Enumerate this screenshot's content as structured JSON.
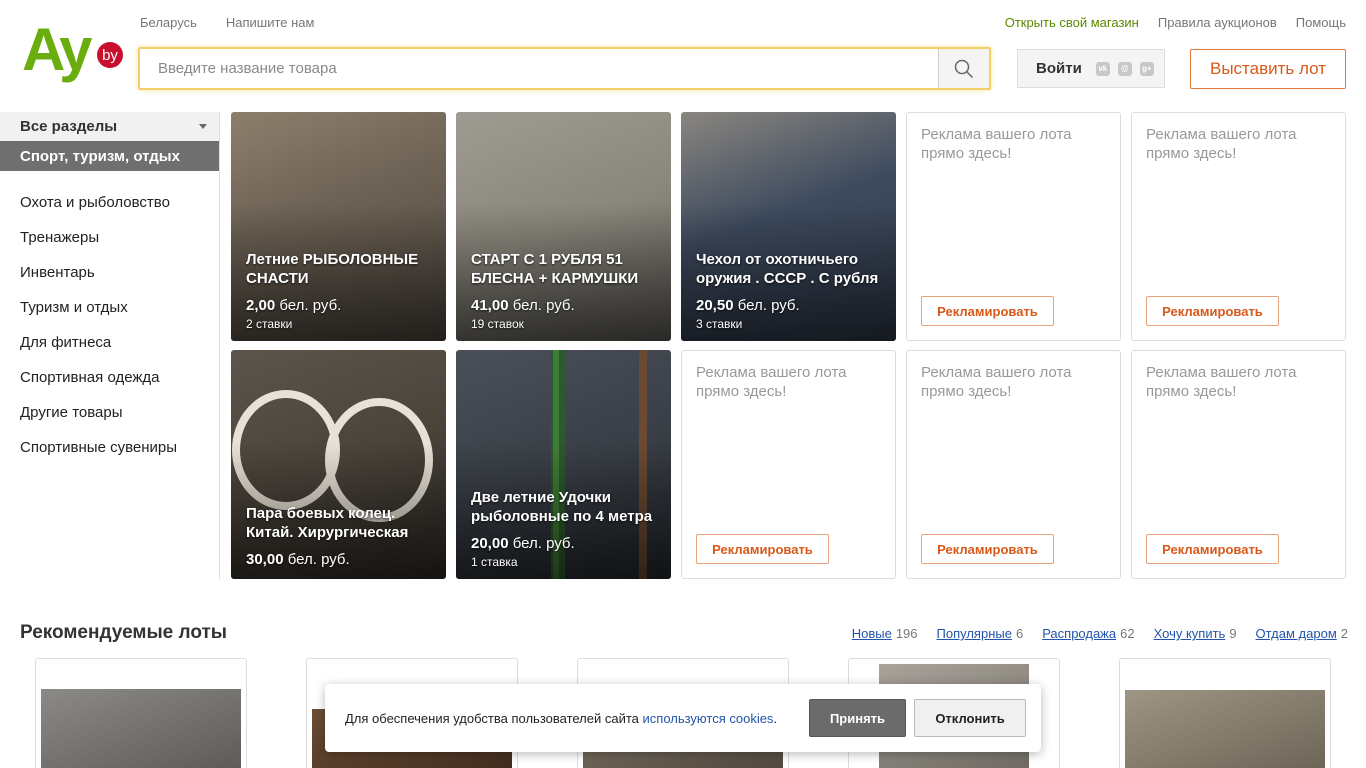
{
  "brand": {
    "logo_text": "Ay",
    "logo_badge": "by",
    "logo_color": "#6aad0e",
    "badge_color": "#c8102e"
  },
  "top_links_left": [
    "Беларусь",
    "Напишите нам"
  ],
  "top_links_right": {
    "shop": "Открыть свой магазин",
    "rules": "Правила аукционов",
    "help": "Помощь"
  },
  "search": {
    "placeholder": "Введите название товара",
    "button_icon": "search-icon"
  },
  "login": {
    "label": "Войти",
    "social_icons": [
      "vk-icon",
      "mail-ru-icon",
      "google-plus-icon"
    ]
  },
  "sell_button": "Выставить лот",
  "sidebar": {
    "all_sections": "Все разделы",
    "current": "Спорт, туризм, отдых",
    "items": [
      "Охота и рыболовство",
      "Тренажеры",
      "Инвентарь",
      "Туризм и отдых",
      "Для фитнеса",
      "Спортивная одежда",
      "Другие товары",
      "Спортивные сувениры"
    ]
  },
  "lots": [
    {
      "title": "Летние РЫБОЛОВНЫЕ СНАСТИ",
      "price": "2,00",
      "currency": "бел. руб.",
      "bids": "2 ставки"
    },
    {
      "title": "СТАРТ С 1 РУБЛЯ 51 БЛЕСНА + КАРМУШКИ",
      "price": "41,00",
      "currency": "бел. руб.",
      "bids": "19 ставок"
    },
    {
      "title": "Чехол от охотничьего оружия . СССР . С рубля",
      "price": "20,50",
      "currency": "бел. руб.",
      "bids": "3 ставки"
    },
    {
      "title": "Пара боевых колец. Китай. Хирургическая",
      "price": "30,00",
      "currency": "бел. руб.",
      "bids": ""
    },
    {
      "title": "Две летние Удочки рыболовные по 4 метра",
      "price": "20,00",
      "currency": "бел. руб.",
      "bids": "1 ставка"
    }
  ],
  "ad_tile": {
    "text": "Реклама вашего лота прямо здесь!",
    "button": "Рекламировать"
  },
  "recommended": {
    "title": "Рекомендуемые лоты",
    "tabs": [
      {
        "label": "Новые",
        "count": "196"
      },
      {
        "label": "Популярные",
        "count": "6"
      },
      {
        "label": "Распродажа",
        "count": "62"
      },
      {
        "label": "Хочу купить",
        "count": "9"
      },
      {
        "label": "Отдам даром",
        "count": "2"
      }
    ]
  },
  "cookie": {
    "text": "Для обеспечения удобства пользователей сайта ",
    "link": "используются cookies",
    "end": ".",
    "accept": "Принять",
    "decline": "Отклонить"
  },
  "colors": {
    "accent": "#d8591a",
    "shop_link": "#5a8a00",
    "link": "#2255aa",
    "search_border": "#f3cf6c"
  }
}
